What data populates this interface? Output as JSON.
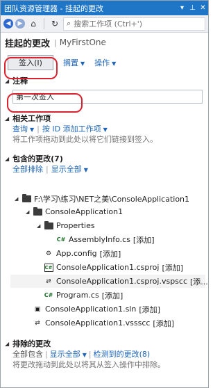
{
  "window": {
    "title": "团队资源管理器 - 挂起的更改",
    "pin_glyph": "▾",
    "pin2_glyph": "⊥",
    "close_glyph": "✕"
  },
  "toolbar": {
    "back_glyph": "◀",
    "forward_glyph": "▶",
    "home_glyph": "⌂",
    "refresh_glyph": "↻",
    "search_placeholder": "搜索工作项 (Ctrl+')"
  },
  "header": {
    "title": "挂起的更改",
    "separator": "|",
    "project": "MyFirstOne"
  },
  "actions": {
    "checkin_label": "签入(I)",
    "shelve_label": "搁置",
    "actions_label": "操作",
    "caret": "▼"
  },
  "comment": {
    "title": "注释",
    "value": "第一次签入"
  },
  "related_work_items": {
    "title": "相关工作项",
    "query_label": "查询",
    "add_by_id_label": "按 ID 添加工作项",
    "hint": "将工作项拖动到此处以将它们链接到签入。"
  },
  "included_changes": {
    "title": "包含的更改(7)",
    "exclude_all_label": "全部排除",
    "view_all_label": "显示全部",
    "pipe": "|",
    "tree": [
      {
        "name": "F:\\学习\\练习\\NET之美\\ConsoleApplication1",
        "icon": "folder-icon",
        "status": ""
      },
      {
        "name": "ConsoleApplication1",
        "icon": "folder-icon",
        "status": ""
      },
      {
        "name": "Properties",
        "icon": "folder-icon",
        "status": ""
      },
      {
        "name": "AssemblyInfo.cs",
        "icon": "csharp-file-icon",
        "status": "[添加]"
      },
      {
        "name": "App.config",
        "icon": "config-file-icon",
        "status": "[添加]"
      },
      {
        "name": "ConsoleApplication1.csproj",
        "icon": "csproj-file-icon",
        "status": "[添加]"
      },
      {
        "name": "ConsoleApplication1.csproj.vspscc",
        "icon": "source-control-file-icon",
        "status": "[添..."
      },
      {
        "name": "Program.cs",
        "icon": "csharp-file-icon",
        "status": "[添加]"
      },
      {
        "name": "ConsoleApplication1.sln",
        "icon": "solution-file-icon",
        "status": "[添加]"
      },
      {
        "name": "ConsoleApplication1.vssscc",
        "icon": "source-control-file-icon",
        "status": "[添加]"
      }
    ]
  },
  "excluded_changes": {
    "title": "排除的更改",
    "include_all_label": "全部包含",
    "view_all_label": "显示全部",
    "detected_label": "检测到的更改(8)",
    "hint": "将更改拖动到此处以将其从签入操作中排除。"
  },
  "glyphs": {
    "expanded": "◢",
    "cs_badge": "C#"
  }
}
